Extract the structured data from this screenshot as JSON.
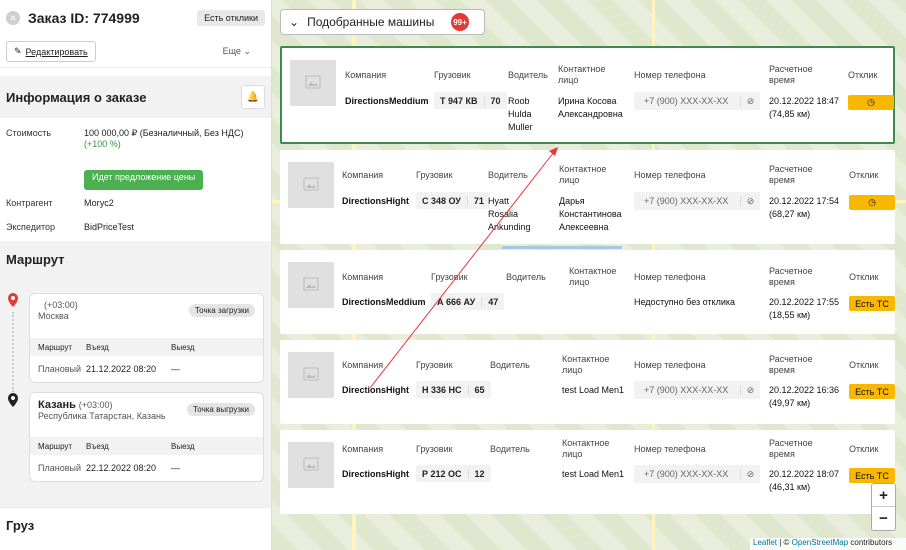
{
  "header": {
    "order_title": "Заказ ID: 774999",
    "responses_button": "Есть отклики",
    "edit_label": "Редактировать",
    "more_label": "Еще"
  },
  "order_info": {
    "title": "Информация о заказе",
    "cost_label": "Стоимость",
    "cost_value": "100 000,00 ₽ (Безналичный, Без НДС)",
    "cost_pct": "(+100 %)",
    "price_offer": "Идет предложение цены",
    "counterparty_label": "Контрагент",
    "counterparty_value": "Могус2",
    "forwarder_label": "Экспедитор",
    "forwarder_value": "BidPriceTest"
  },
  "route": {
    "title": "Маршрут",
    "points": [
      {
        "city": "",
        "tz": "(+03:00)",
        "region": "Москва",
        "tag": "Точка загрузки",
        "h_route": "Маршрут",
        "h_in": "Въезд",
        "h_out": "Выезд",
        "row_label": "Плановый",
        "in": "21.12.2022 08:20",
        "out": "—"
      },
      {
        "city": "Казань",
        "tz": "(+03:00)",
        "region": "Республика Татарстан, Казань",
        "tag": "Точка выгрузки",
        "h_route": "Маршрут",
        "h_in": "Въезд",
        "h_out": "Выезд",
        "row_label": "Плановый",
        "in": "22.12.2022 08:20",
        "out": "—"
      }
    ]
  },
  "cargo": {
    "title": "Груз"
  },
  "vehicles_panel": {
    "button_label": "Подобранные машины",
    "badge": "99+"
  },
  "columns": {
    "company": "Компания",
    "truck": "Грузовик",
    "driver": "Водитель",
    "contact": "Контактное лицо",
    "phone": "Номер телефона",
    "eta": "Расчетное время",
    "response": "Отклик"
  },
  "vehicles": [
    {
      "company": "DirectionsMeddium",
      "plate": "Т 947 КВ",
      "region": "70",
      "driver": "Roob Hulda Muller",
      "contact": "Ирина Косова Александровна",
      "phone": "+7 (900) XXX-XX-XX",
      "eta_date": "20.12.2022 18:47",
      "eta_km": "(74,85 км)",
      "response": "",
      "icon": "clock-icon"
    },
    {
      "company": "DirectionsHight",
      "plate": "С 348 ОУ",
      "region": "71",
      "driver": "Hyatt Rosalia Ankunding",
      "contact": "Дарья Константинова Алексеевна",
      "phone": "+7 (900) XXX-XX-XX",
      "eta_date": "20.12.2022 17:54",
      "eta_km": "(68,27 км)",
      "response": "",
      "icon": "clock-icon"
    },
    {
      "company": "DirectionsMeddium",
      "plate": "А 666 АУ",
      "region": "47",
      "driver": "",
      "contact": "",
      "phone": "Недоступно без отклика",
      "eta_date": "20.12.2022 17:55",
      "eta_km": "(18,55 км)",
      "response": "Есть ТС",
      "icon": ""
    },
    {
      "company": "DirectionsHight",
      "plate": "Н 336 НС",
      "region": "65",
      "driver": "",
      "contact": "test Load Men1",
      "phone": "+7 (900) XXX-XX-XX",
      "eta_date": "20.12.2022 16:36",
      "eta_km": "(49,97 км)",
      "response": "Есть ТС",
      "icon": ""
    },
    {
      "company": "DirectionsHight",
      "plate": "Р 212 ОС",
      "region": "12",
      "driver": "",
      "contact": "test Load Men1",
      "phone": "+7 (900) XXX-XX-XX",
      "eta_date": "20.12.2022 18:07",
      "eta_km": "(46,31 км)",
      "response": "Есть ТС",
      "icon": ""
    }
  ],
  "map": {
    "zoom_in": "+",
    "zoom_out": "−",
    "attribution_leaflet": "Leaflet",
    "attribution_sep": " | © ",
    "attribution_osm": "OpenStreetMap",
    "attribution_tail": " contributors"
  },
  "colors": {
    "accent_orange": "#f9b700",
    "selected_border": "#3d8b4a",
    "badge_red": "#e53935",
    "pill_green": "#4caf50"
  }
}
